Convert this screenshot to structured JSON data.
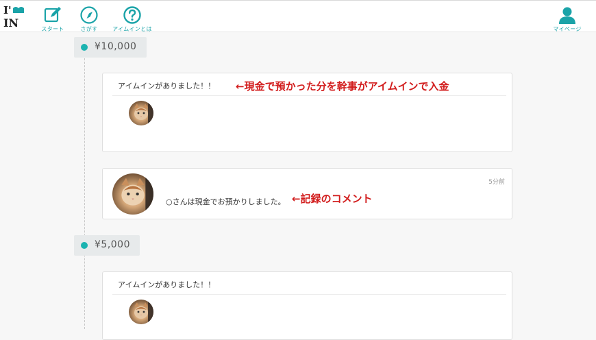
{
  "header": {
    "logo_text": "I'IN",
    "nav": [
      {
        "label": "スタート",
        "icon": "edit-icon"
      },
      {
        "label": "さがす",
        "icon": "compass-icon"
      },
      {
        "label": "アイムインとは",
        "icon": "question-icon"
      }
    ],
    "mypage": {
      "label": "マイページ",
      "icon": "user-icon"
    }
  },
  "timeline": [
    {
      "amount": "¥10,000",
      "card": {
        "message": "アイムインがありました！！"
      },
      "comment": {
        "time": "5分前",
        "text": "○さんは現金でお預かりしました。"
      }
    },
    {
      "amount": "¥5,000",
      "card": {
        "message": "アイムインがありました！！"
      }
    }
  ],
  "annotations": {
    "deposit_note": "←現金で預かった分を幹事がアイムインで入金",
    "comment_note": "←記録のコメント"
  },
  "colors": {
    "accent": "#1aa3a8",
    "dot": "#1ab3b0",
    "annotation": "#d21d1d"
  }
}
